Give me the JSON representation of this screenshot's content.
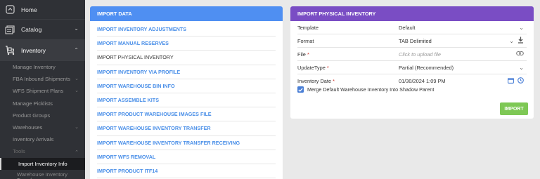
{
  "sidebar": {
    "home": "Home",
    "catalog": "Catalog",
    "inventory": "Inventory",
    "items": [
      {
        "label": "Manage Inventory"
      },
      {
        "label": "FBA Inbound Shipments"
      },
      {
        "label": "WFS Shipment Plans"
      },
      {
        "label": "Manage Picklists"
      },
      {
        "label": "Product Groups"
      },
      {
        "label": "Warehouses"
      },
      {
        "label": "Inventory Arrivals"
      },
      {
        "label": "Tools"
      },
      {
        "label": "Import Inventory Info"
      },
      {
        "label": "Warehouse Inventory Transfer"
      }
    ]
  },
  "import_data": {
    "title": "IMPORT DATA",
    "items": [
      "IMPORT INVENTORY ADJUSTMENTS",
      "IMPORT MANUAL RESERVES",
      "IMPORT PHYSICAL INVENTORY",
      "IMPORT INVENTORY VIA PROFILE",
      "IMPORT WAREHOUSE BIN INFO",
      "IMPORT ASSEMBLE KITS",
      "IMPORT PRODUCT WAREHOUSE IMAGES FILE",
      "IMPORT WAREHOUSE INVENTORY TRANSFER",
      "IMPORT WAREHOUSE INVENTORY TRANSFER RECEIVING",
      "IMPORT WFS REMOVAL",
      "IMPORT PRODUCT ITF14"
    ]
  },
  "physical": {
    "title": "IMPORT PHYSICAL INVENTORY",
    "template_label": "Template",
    "template_value": "Default",
    "format_label": "Format",
    "format_value": "TAB Delimited",
    "file_label": "File",
    "file_placeholder": "Click to upload file",
    "updatetype_label": "UpdateType",
    "updatetype_value": "Partial (Recommended)",
    "date_label": "Inventory Date",
    "date_value": "01/30/2024 1:09 PM",
    "required_mark": "*",
    "checkbox_label": "Merge Default Warehouse Inventory Into Shadow Parent",
    "import_button": "IMPORT"
  },
  "colors": {
    "sidebar_bg": "#2f3136",
    "import_data_header": "#4f8ff2",
    "physical_header": "#7a4dc4",
    "link_blue": "#4a8fe8",
    "import_button": "#7ec855"
  }
}
